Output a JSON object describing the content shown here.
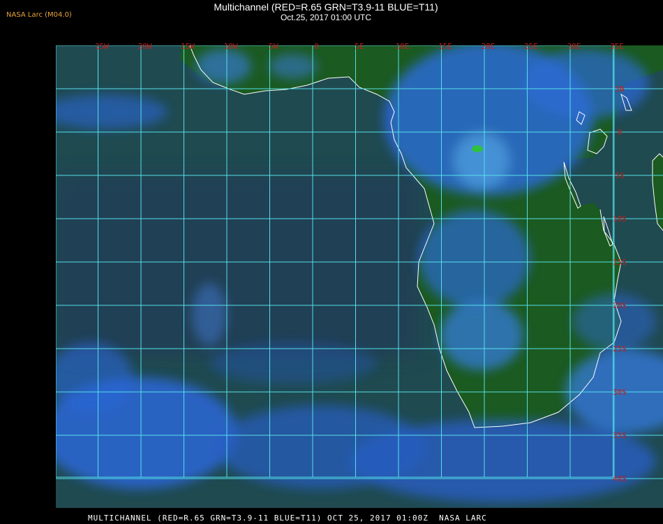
{
  "header": {
    "credit": "NASA Larc (M04.0)",
    "title": "Multichannel (RED=R.65 GRN=T3.9-11 BLUE=T11)",
    "datetime": "Oct.25, 2017 01:00 UTC"
  },
  "footer": {
    "text": "MULTICHANNEL (RED=R.65 GRN=T3.9-11 BLUE=T11) OCT 25, 2017 01:00Z  NASA LARC"
  },
  "map": {
    "grid_color": "#55e0e8",
    "label_color": "#c02020",
    "coast_color": "#ffffff",
    "ocean_color": "#1f4a50",
    "land_color": "#1d5a22",
    "cloud_color": "#2e6df0",
    "longitude_labels": [
      "25W",
      "20W",
      "15W",
      "10W",
      "5W",
      "0",
      "5E",
      "10E",
      "15E",
      "20E",
      "25E",
      "30E",
      "35E"
    ],
    "latitude_labels": [
      "5N",
      "0",
      "5S",
      "10S",
      "15S",
      "20S",
      "25S",
      "30S",
      "35S",
      "40S"
    ]
  }
}
